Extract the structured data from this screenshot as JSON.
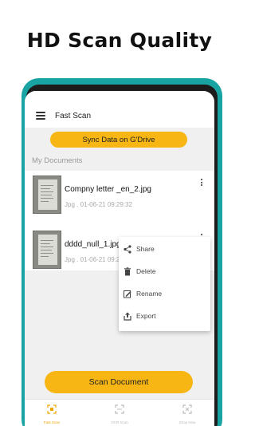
{
  "headline": "HD Scan Quality",
  "app": {
    "title": "Fast Scan",
    "sync_label": "Sync Data on G'Drive",
    "section_label": "My Documents",
    "documents": [
      {
        "name": "Compny letter _en_2.jpg",
        "meta": "Jpg . 01-06-21 09:29:32"
      },
      {
        "name": "dddd_null_1.jpg",
        "meta": "Jpg . 01-06-21 09:29:19"
      }
    ],
    "context_menu": [
      "Share",
      "Delete",
      "Rename",
      "Export"
    ],
    "scan_label": "Scan Document",
    "nav": [
      {
        "label": "Fast Scan",
        "icon": "scan-icon",
        "active": true
      },
      {
        "label": "OCR Scan",
        "icon": "ocr-icon",
        "active": false
      },
      {
        "label": "Shop Now",
        "icon": "shop-icon",
        "active": false
      }
    ]
  },
  "colors": {
    "accent": "#f7b614",
    "frame": "#1aa3a3",
    "active_nav": "#f0a400"
  }
}
